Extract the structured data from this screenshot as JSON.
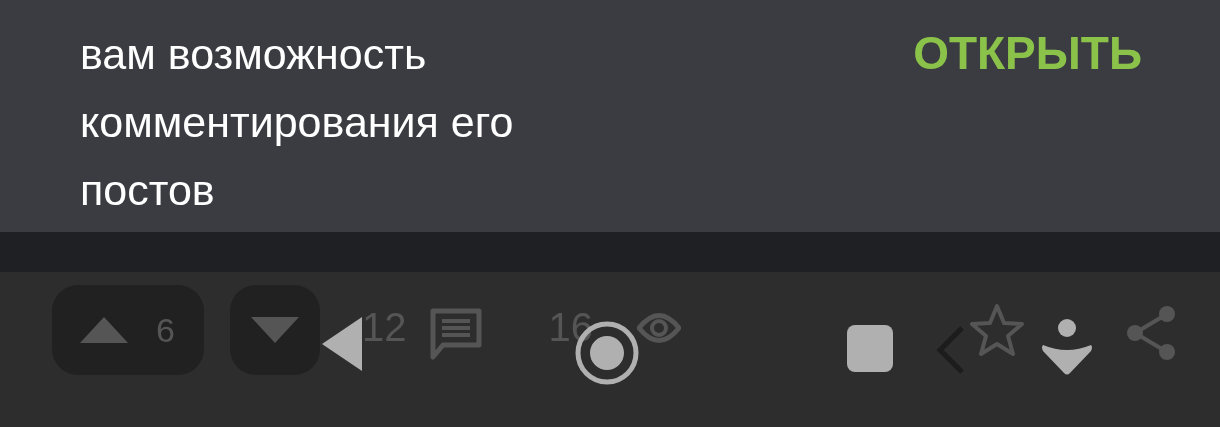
{
  "snackbar": {
    "message": "вам возможность\nкомментирования его\nпостов",
    "action": "ОТКРЫТЬ"
  },
  "post_toolbar": {
    "upvotes": "6",
    "comments": "12",
    "views": "16"
  }
}
